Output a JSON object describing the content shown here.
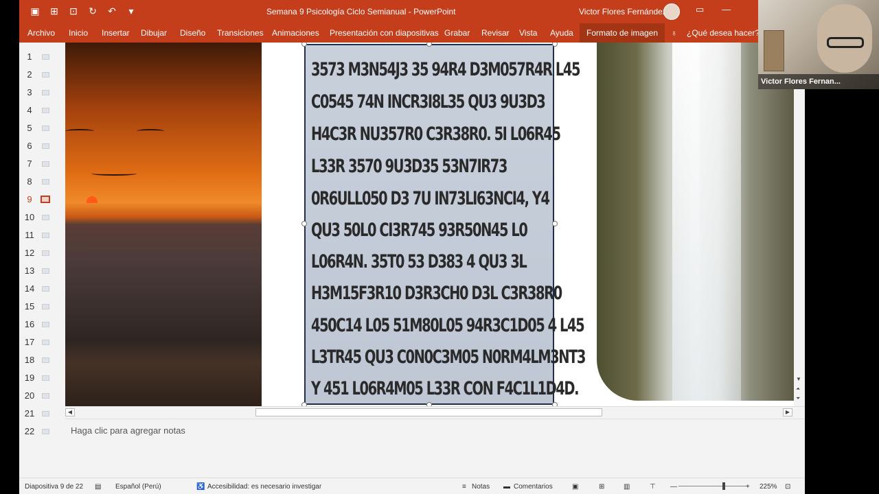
{
  "titlebar": {
    "title": "Semana 9 Psicología Ciclo Semianual  -  PowerPoint",
    "user_name": "Victor Flores Fernández",
    "qat_icons": [
      "save-icon",
      "presenter-icon",
      "open-icon",
      "repeat-icon",
      "undo-icon",
      "customize-icon"
    ]
  },
  "ribbon": {
    "tabs": [
      "Archivo",
      "Inicio",
      "Insertar",
      "Dibujar",
      "Diseño",
      "Transiciones",
      "Animaciones",
      "Presentación con diapositivas",
      "Grabar",
      "Revisar",
      "Vista",
      "Ayuda",
      "Formato de imagen"
    ],
    "tell_me": "¿Qué desea hacer?"
  },
  "thumbnails": {
    "numbers": [
      "1",
      "2",
      "3",
      "4",
      "5",
      "6",
      "7",
      "8",
      "9",
      "10",
      "11",
      "12",
      "13",
      "14",
      "15",
      "16",
      "17",
      "18",
      "19",
      "20",
      "21",
      "22"
    ],
    "active": "9"
  },
  "slide": {
    "text_lines": [
      "3573 M3N54J3 35 94R4 D3M057R4R L45",
      "C0545 74N INCR3I8L35 QU3 9U3D3",
      "H4C3R NU357R0 C3R38R0. 5I L06R45",
      "L33R 3570 9U3D35 53N7IR73",
      "0R6ULL050 D3 7U IN73LI63NCI4, Y4",
      "QU3 50L0 CI3R745 93R50N45 L0",
      "L06R4N. 35T0 53 D383 4 QU3 3L",
      "H3M15F3R10 D3R3CH0 D3L C3R38R0",
      "450C14 L05 51M80L05 94R3C1D05 4 L45",
      "L3TR45 QU3 C0N0C3M05 N0RM4LM3NT3",
      "Y 451 L06R4M05 L33R CON F4C1L1D4D."
    ]
  },
  "notes": {
    "placeholder": "Haga clic para agregar notas"
  },
  "status": {
    "slide_info": "Diapositiva 9 de 22",
    "language": "Español (Perú)",
    "accessibility": "Accesibilidad: es necesario investigar",
    "notes": "Notas",
    "comments": "Comentarios",
    "zoom": "225%"
  },
  "webcam": {
    "name": "Victor Flores Fernan..."
  }
}
